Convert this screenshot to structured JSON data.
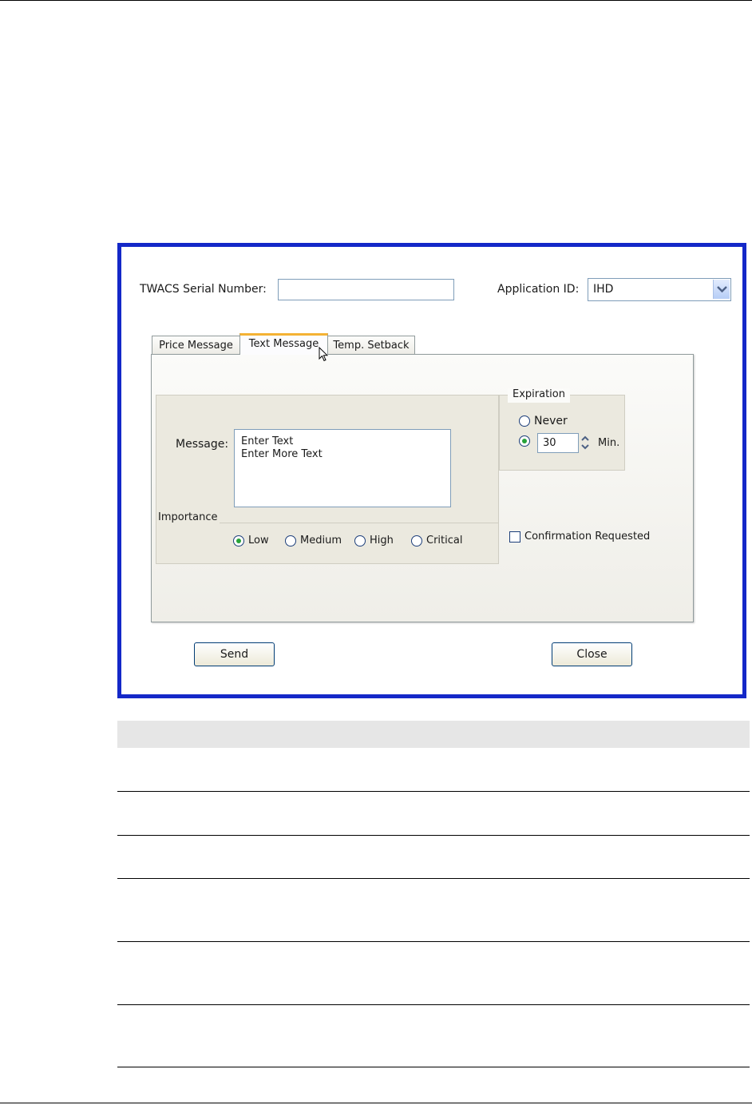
{
  "dialog": {
    "serial_label": "TWACS Serial Number:",
    "serial_value": "",
    "appid_label": "Application ID:",
    "appid_value": "IHD",
    "tabs": [
      {
        "label": "Price Message",
        "active": false
      },
      {
        "label": "Text Message",
        "active": true
      },
      {
        "label": "Temp. Setback",
        "active": false
      }
    ],
    "message_label": "Message:",
    "message_lines": [
      "Enter Text",
      "Enter More Text"
    ],
    "importance": {
      "legend": "Importance",
      "options": [
        {
          "label": "Low",
          "selected": true
        },
        {
          "label": "Medium",
          "selected": false
        },
        {
          "label": "High",
          "selected": false
        },
        {
          "label": "Critical",
          "selected": false
        }
      ]
    },
    "expiration": {
      "legend": "Expiration",
      "never_label": "Never",
      "never_selected": false,
      "minutes_selected": true,
      "minutes_value": "30",
      "minutes_unit": "Min."
    },
    "confirmation_label": "Confirmation Requested",
    "confirmation_checked": false,
    "send_label": "Send",
    "close_label": "Close"
  },
  "colors": {
    "frame": "#1428c8",
    "active_tab_accent": "#f4b234",
    "radio_selected": "#27a33a"
  }
}
